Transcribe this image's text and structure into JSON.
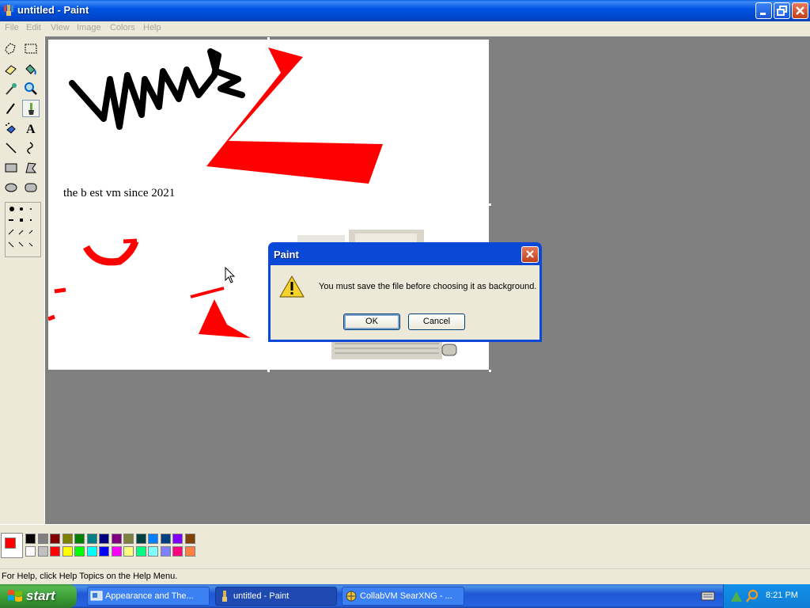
{
  "window": {
    "title": "untitled - Paint"
  },
  "menu": [
    "File",
    "Edit",
    "View",
    "Image",
    "Colors",
    "Help"
  ],
  "tools": [
    {
      "name": "free-form-select-tool"
    },
    {
      "name": "select-tool"
    },
    {
      "name": "eraser-tool"
    },
    {
      "name": "fill-tool"
    },
    {
      "name": "pick-color-tool"
    },
    {
      "name": "magnifier-tool"
    },
    {
      "name": "pencil-tool"
    },
    {
      "name": "brush-tool",
      "selected": true
    },
    {
      "name": "airbrush-tool"
    },
    {
      "name": "text-tool"
    },
    {
      "name": "line-tool"
    },
    {
      "name": "curve-tool"
    },
    {
      "name": "rectangle-tool"
    },
    {
      "name": "polygon-tool"
    },
    {
      "name": "ellipse-tool"
    },
    {
      "name": "rounded-rectangle-tool"
    }
  ],
  "canvas": {
    "caption": "the b  est vm since 2021"
  },
  "palette": {
    "foreground": "#ff0000",
    "background": "#ffffff",
    "row1": [
      "#000000",
      "#808080",
      "#800000",
      "#808000",
      "#008000",
      "#008080",
      "#000080",
      "#800080",
      "#808040",
      "#004040",
      "#0080ff",
      "#004080",
      "#8000ff",
      "#804000"
    ],
    "row2": [
      "#ffffff",
      "#c0c0c0",
      "#ff0000",
      "#ffff00",
      "#00ff00",
      "#00ffff",
      "#0000ff",
      "#ff00ff",
      "#ffff80",
      "#00ff80",
      "#80ffff",
      "#8080ff",
      "#ff0080",
      "#ff8040"
    ]
  },
  "status": {
    "text": "For Help, click Help Topics on the Help Menu."
  },
  "dialog": {
    "title": "Paint",
    "message": "You must save the file before choosing it as background.",
    "ok_label": "OK",
    "cancel_label": "Cancel"
  },
  "taskbar": {
    "start_label": "start",
    "tasks": [
      {
        "label": "Appearance and The...",
        "active": false
      },
      {
        "label": "untitled - Paint",
        "active": true
      },
      {
        "label": "CollabVM SearXNG - ...",
        "active": false
      }
    ],
    "clock": "8:21 PM"
  }
}
